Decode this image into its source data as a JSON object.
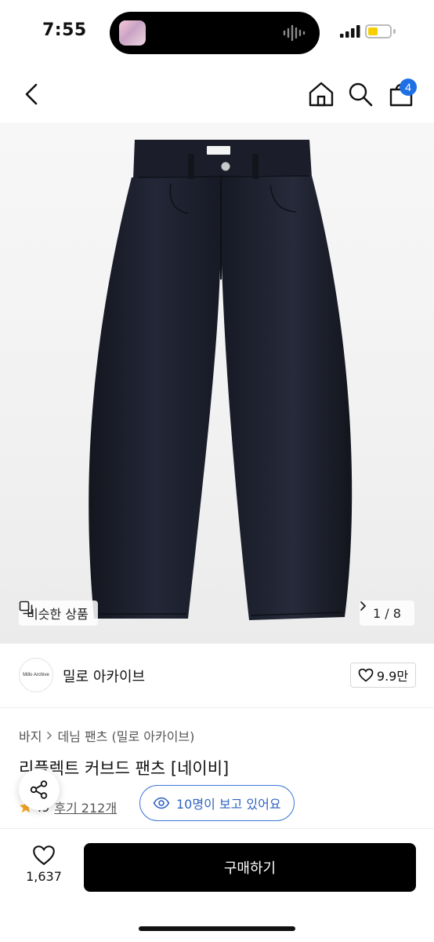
{
  "status_bar": {
    "time": "7:55"
  },
  "nav": {
    "cart_count": "4",
    "icons": [
      "back-icon",
      "home-icon",
      "search-icon",
      "cart-icon"
    ]
  },
  "hero": {
    "similar_label": "비슷한 상품",
    "page_indicator": "1 / 8"
  },
  "shop": {
    "logo_text": "Millo Archive",
    "name": "밀로 아카이브",
    "likes": "9.9만"
  },
  "breadcrumb": [
    "바지",
    "데님 팬츠 (밀로 아카이브)"
  ],
  "product": {
    "title": "리플렉트 커브드 팬츠 [네이비]",
    "rating": ".9",
    "reviews": "후기 212개",
    "viewers": "10명이 보고 있어요"
  },
  "bottom_bar": {
    "wish_count": "1,637",
    "buy_label": "구매하기"
  },
  "colors": {
    "accent": "#1f6fe5",
    "product": "#1c1f2b",
    "buy_button": "#000000"
  }
}
